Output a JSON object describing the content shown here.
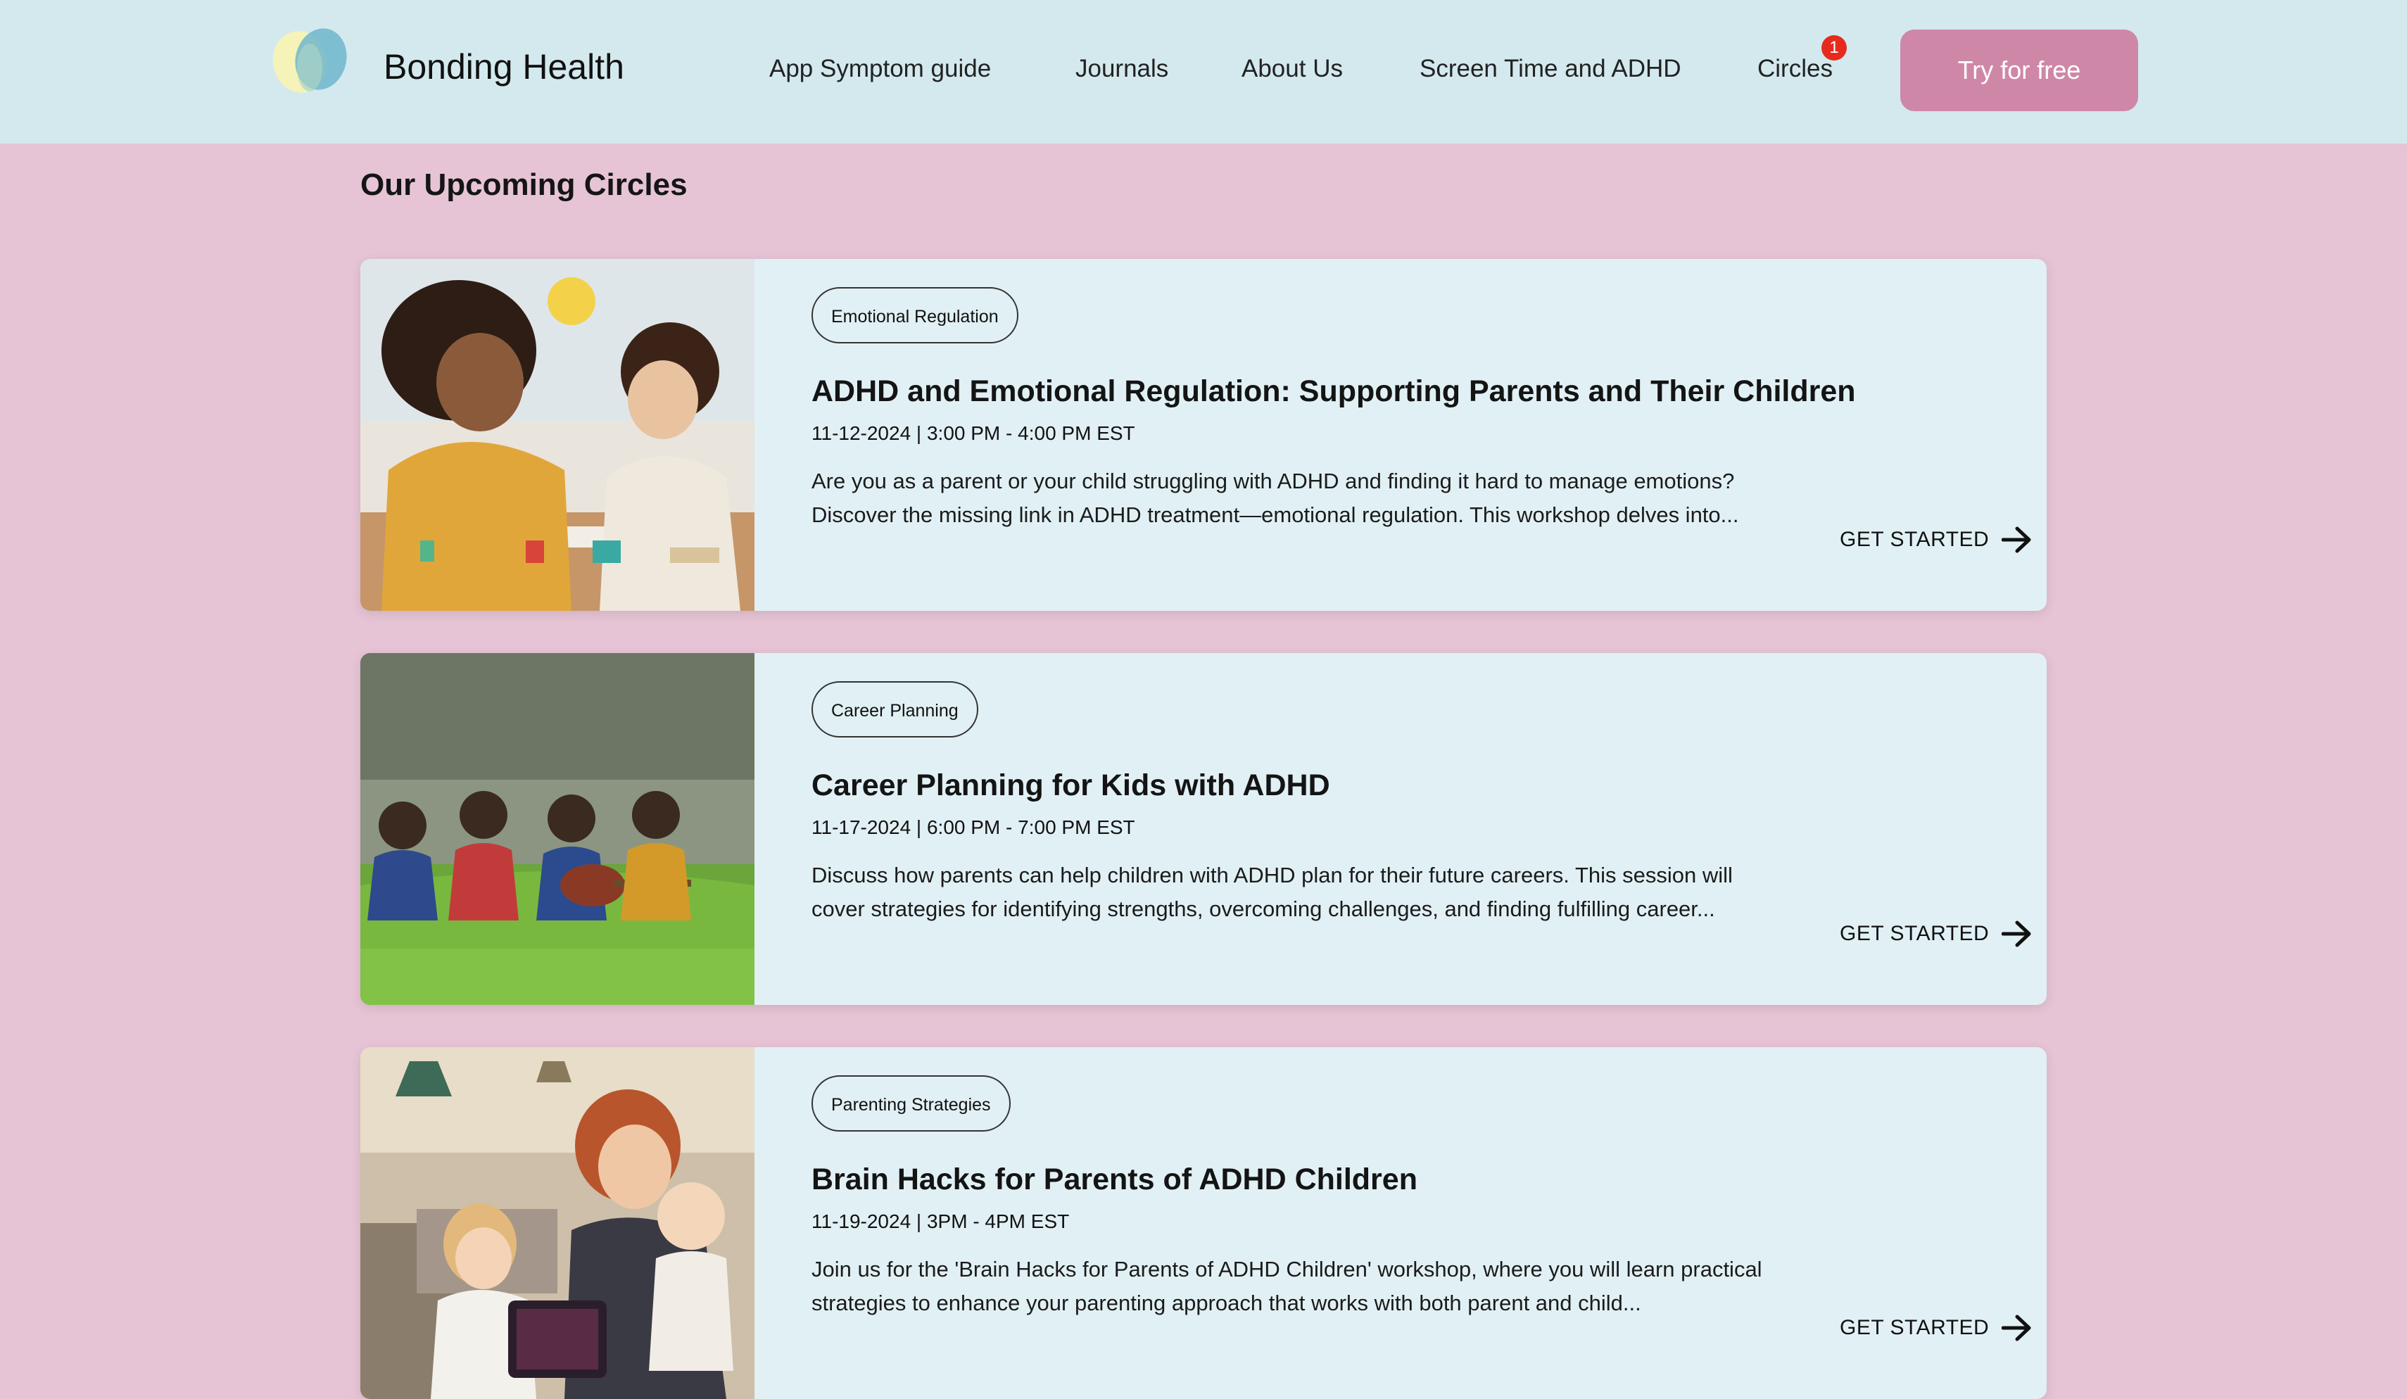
{
  "header": {
    "brand": "Bonding Health",
    "nav": [
      {
        "label": "App Symptom guide"
      },
      {
        "label": "Journals"
      },
      {
        "label": "About Us"
      },
      {
        "label": "Screen Time and ADHD"
      },
      {
        "label": "Circles",
        "badge": "1"
      }
    ],
    "cta_label": "Try for free",
    "icons": {
      "logo": "heart-logo-icon"
    }
  },
  "main": {
    "title": "Our Upcoming Circles",
    "circles": [
      {
        "tag": "Emotional Regulation",
        "title": "ADHD and Emotional Regulation: Supporting Parents and Their Children",
        "date": "11-12-2024 | 3:00 PM - 4:00 PM EST",
        "description": "Are you as a parent or your child struggling with ADHD and finding it hard to manage emotions? Discover the missing link in ADHD treatment—emotional regulation. This workshop delves into...",
        "cta": "GET STARTED",
        "image": "photo-mother-and-daughter-drawing"
      },
      {
        "tag": "Career Planning",
        "title": "Career Planning for Kids with ADHD",
        "date": "11-17-2024 | 6:00 PM - 7:00 PM EST",
        "description": "Discuss how parents can help children with ADHD plan for their future careers. This session will cover strategies for identifying strengths, overcoming challenges, and finding fulfilling career...",
        "cta": "GET STARTED",
        "image": "photo-kids-sitting-in-grass"
      },
      {
        "tag": "Parenting Strategies",
        "title": "Brain Hacks for Parents of ADHD Children",
        "date": "11-19-2024 | 3PM - 4PM EST",
        "description": "Join us for the 'Brain Hacks for Parents of ADHD Children' workshop, where you will learn practical strategies to enhance your parenting approach that works with both parent and child...",
        "cta": "GET STARTED",
        "image": "photo-mother-with-children-tablet"
      }
    ]
  },
  "colors": {
    "page_background": "#e6c4d5",
    "header_background": "#d3e9ee",
    "card_background": "#e1f0f4",
    "cta_button": "#cf87a8",
    "badge": "#e62b1e"
  }
}
